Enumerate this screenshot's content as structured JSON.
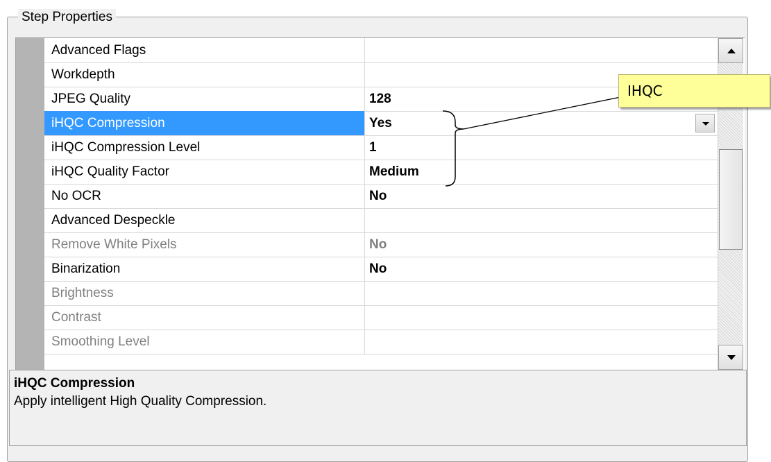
{
  "group_title": "Step Properties",
  "rows": [
    {
      "name": "Advanced Flags",
      "value": ""
    },
    {
      "name": "Workdepth",
      "value": ""
    },
    {
      "name": "JPEG Quality",
      "value": "128"
    },
    {
      "name": "iHQC Compression",
      "value": "Yes"
    },
    {
      "name": "iHQC Compression Level",
      "value": "1"
    },
    {
      "name": "iHQC Quality Factor",
      "value": "Medium"
    },
    {
      "name": "No OCR",
      "value": "No"
    },
    {
      "name": "Advanced Despeckle",
      "value": ""
    },
    {
      "name": "Remove White Pixels",
      "value": "No"
    },
    {
      "name": "Binarization",
      "value": "No"
    },
    {
      "name": "Brightness",
      "value": ""
    },
    {
      "name": "Contrast",
      "value": ""
    },
    {
      "name": "Smoothing Level",
      "value": ""
    }
  ],
  "description": {
    "title": "iHQC Compression",
    "text": "Apply intelligent High Quality Compression."
  },
  "callout": {
    "label": "IHQC"
  },
  "colors": {
    "selection": "#3399ff",
    "callout_bg": "#ffff99",
    "disabled_text": "#808080"
  },
  "icons": {
    "dropdown": "chevron-down-icon",
    "scroll_up": "arrow-up-icon",
    "scroll_down": "arrow-down-icon"
  }
}
